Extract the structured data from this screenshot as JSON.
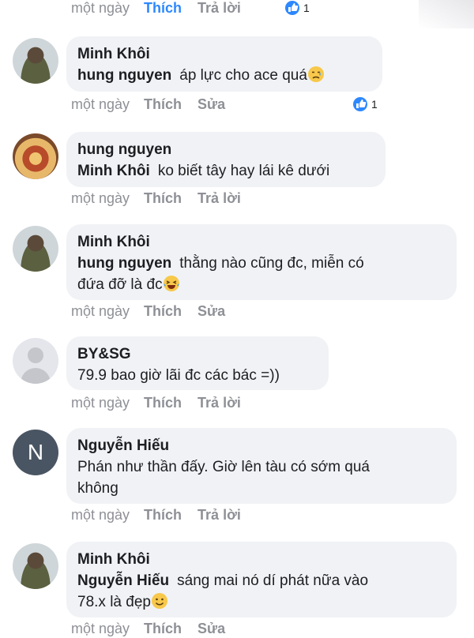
{
  "labels": {
    "time": "một ngày",
    "like": "Thích",
    "reply": "Trả lời",
    "edit": "Sửa"
  },
  "top_meta": {
    "reaction_count": "1"
  },
  "comments": [
    {
      "author": "Minh Khôi",
      "mention": "hung nguyen",
      "text": "áp lực cho ace quá",
      "emoji": "crying-face",
      "action": "Sửa",
      "reaction_count": "1",
      "avatar": "profile-photo"
    },
    {
      "author": "hung nguyen",
      "mention": "Minh Khôi",
      "text": "ko biết tây hay lái kê dưới",
      "action": "Trả lời",
      "avatar": "food-photo"
    },
    {
      "author": "Minh Khôi",
      "mention": "hung nguyen",
      "text": "thằng nào cũng đc, miễn có",
      "text2": "đứa đỡ là đc",
      "emoji": "laughing-face",
      "action": "Sửa",
      "avatar": "profile-photo"
    },
    {
      "author": "BY&SG",
      "text": "79.9 bao giờ lãi đc các bác =))",
      "action": "Trả lời",
      "avatar": "default-silhouette"
    },
    {
      "author": "Nguyễn Hiếu",
      "text": "Phán như thần đấy. Giờ lên tàu có sớm quá",
      "text2": "không",
      "action": "Trả lời",
      "avatar_letter": "N"
    },
    {
      "author": "Minh Khôi",
      "mention": "Nguyễn Hiếu",
      "text": "sáng mai nó dí phát nữa vào",
      "text2": "78.x là đẹp",
      "emoji": "smiling-face",
      "action": "Sửa",
      "avatar": "profile-photo"
    }
  ],
  "colors": {
    "link_blue": "#2d88ff",
    "bubble": "#f0f2f5",
    "meta": "#8e9096"
  }
}
